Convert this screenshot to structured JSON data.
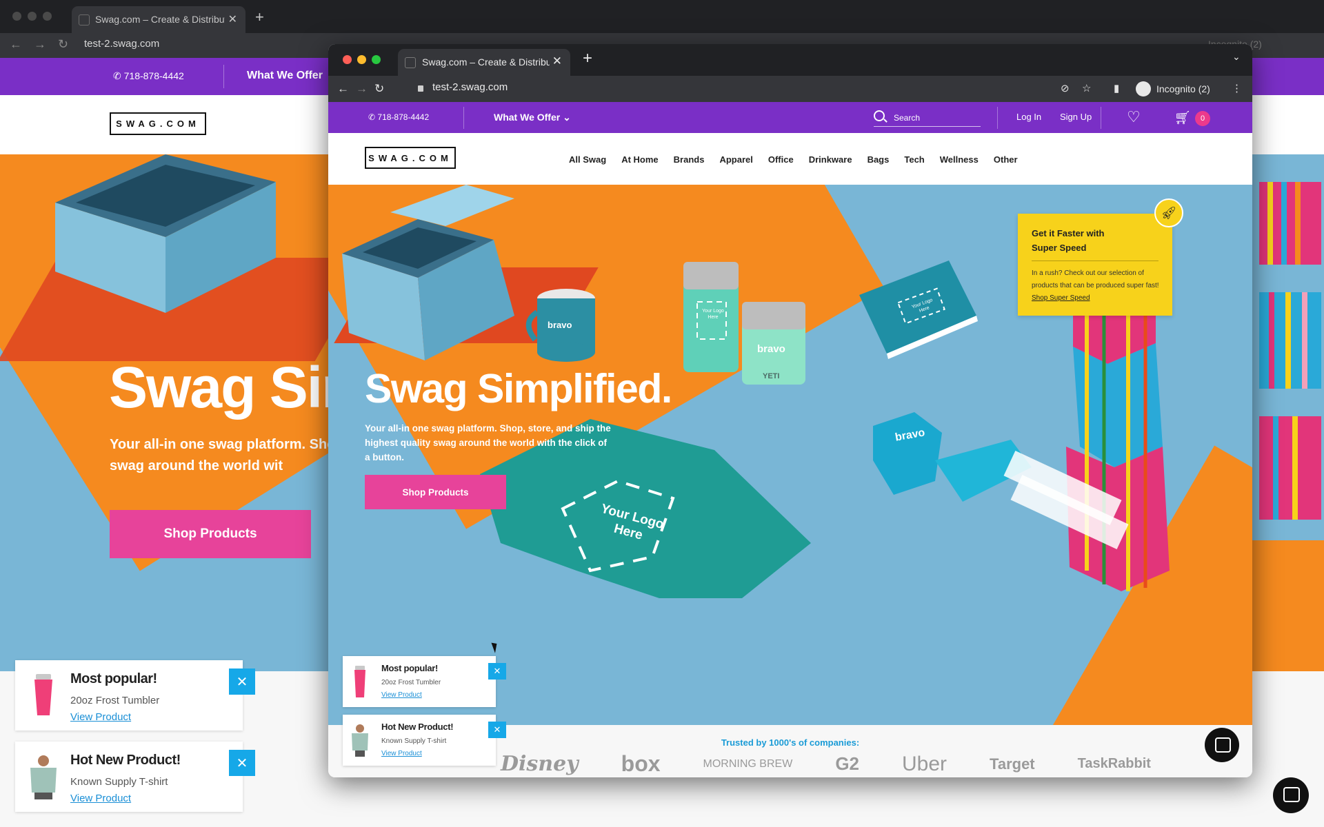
{
  "colors": {
    "purple": "#7a2fc6",
    "pink": "#e7439a",
    "orange": "#f58a1f",
    "sky_blue": "#79b6d6",
    "yellow": "#f7d21b",
    "link_blue": "#1a8fd6",
    "close_blue": "#16a8e8"
  },
  "background_window": {
    "tab_title": "Swag.com – Create & Distribut",
    "url": "test-2.swag.com",
    "incognito": "Incognito (2)",
    "phone": "718-878-4442",
    "offer": "What We Offer",
    "logo": "SWAG.COM",
    "hero_title": "Swag Sir",
    "hero_sub": "Your all-in one swag platform. Sho quality swag around the world wit",
    "shop_button": "Shop Products",
    "cards": [
      {
        "title": "Most popular!",
        "desc": "20oz Frost Tumbler",
        "link": "View Product"
      },
      {
        "title": "Hot New Product!",
        "desc": "Known Supply T-shirt",
        "link": "View Product"
      }
    ],
    "close_glyph": "✕"
  },
  "browser": {
    "tab_title": "Swag.com – Create & Distribut",
    "tab_close": "✕",
    "new_tab": "+",
    "url": "test-2.swag.com",
    "incognito": "Incognito (2)",
    "back": "←",
    "forward": "→",
    "reload": "↻",
    "menu": "⋮",
    "caret": "⌄"
  },
  "promo_bar": {
    "phone": "718-878-4442",
    "offer": "What We Offer",
    "search_placeholder": "Search",
    "login": "Log In",
    "signup": "Sign Up",
    "cart_count": "0"
  },
  "header": {
    "logo": "SWAG.COM",
    "menu": [
      "All Swag",
      "At Home",
      "Brands",
      "Apparel",
      "Office",
      "Drinkware",
      "Bags",
      "Tech",
      "Wellness",
      "Other"
    ]
  },
  "hero": {
    "title": "Swag Simplified.",
    "subtitle": "Your all-in one swag platform. Shop, store, and ship the highest quality swag around the world with the click of a button.",
    "shop_button": "Shop Products",
    "mug_label": "bravo",
    "tumbler_label": "bravo",
    "tumbler_brand": "YETI",
    "tumbler_logo_text": "Your Logo Here",
    "notebook_logo_text": "Your Logo Here",
    "dispenser_label": "bravo",
    "shirt_logo_text": "Your Logo Here"
  },
  "speed_card": {
    "title": "Get it Faster with Super Speed",
    "body": "In a rush? Check out our selection of products that can be produced super fast!",
    "link": "Shop Super Speed"
  },
  "trusted": {
    "label": "Trusted by 1000's of companies:",
    "logos": [
      "Disney",
      "box",
      "MORNING BREW",
      "G2",
      "Uber",
      "Target",
      "TaskRabbit"
    ]
  },
  "product_cards": [
    {
      "title": "Most popular!",
      "desc": "20oz Frost Tumbler",
      "link": "View Product"
    },
    {
      "title": "Hot New Product!",
      "desc": "Known Supply T-shirt",
      "link": "View Product"
    }
  ],
  "icons": {
    "phone": "phone-icon",
    "chevron": "chevron-down-icon",
    "search": "search-icon",
    "heart": "heart-icon",
    "cart": "cart-icon",
    "rocket": "rocket-icon",
    "chat": "chat-icon"
  }
}
